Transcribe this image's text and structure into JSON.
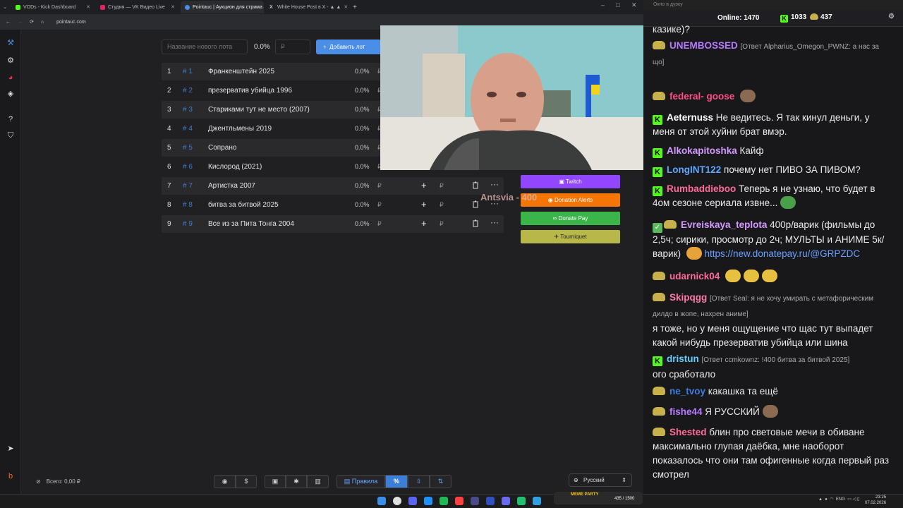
{
  "browser": {
    "tabs": [
      {
        "label": "VODs - Kick Dashboard",
        "color": "#53fc18",
        "active": false
      },
      {
        "label": "Студия — VK Видео Live",
        "color": "#e0245e",
        "active": false
      },
      {
        "label": "Pointauc | Аукцион для стрима",
        "color": "#4a8ee8",
        "active": true
      },
      {
        "label": "White House Post в X - ▲ ▲",
        "color": "#ffffff",
        "active": false
      }
    ],
    "url": "pointauc.com"
  },
  "form": {
    "lot_placeholder": "Название нового лота",
    "percent": "0.0%",
    "amount_placeholder": "₽",
    "add_label": "Добавить лот"
  },
  "lots": [
    {
      "n": "1",
      "id": "# 1",
      "name": "Франкенштейн 2025",
      "pct": "0.0%",
      "rub": "₽"
    },
    {
      "n": "2",
      "id": "# 2",
      "name": "презерватив убийца 1996",
      "pct": "0.0%",
      "rub": "₽"
    },
    {
      "n": "3",
      "id": "# 3",
      "name": "Стариками тут не место (2007)",
      "pct": "0.0%",
      "rub": "₽"
    },
    {
      "n": "4",
      "id": "# 4",
      "name": "Джентльмены 2019",
      "pct": "0.0%",
      "rub": "₽"
    },
    {
      "n": "5",
      "id": "# 5",
      "name": "Сопрано",
      "pct": "0.0%",
      "rub": "₽"
    },
    {
      "n": "6",
      "id": "# 6",
      "name": "Кислород (2021)",
      "pct": "0.0%",
      "rub": "₽"
    },
    {
      "n": "7",
      "id": "# 7",
      "name": "Артистка 2007",
      "pct": "0.0%",
      "rub": "₽"
    },
    {
      "n": "8",
      "id": "# 8",
      "name": "битва за битвой 2025",
      "pct": "0.0%",
      "rub": "₽"
    },
    {
      "n": "9",
      "id": "# 9",
      "name": "Все из за Пита Тонга 2004",
      "pct": "0.0%",
      "rub": "₽"
    }
  ],
  "donation_buttons": [
    {
      "label": "Twitch",
      "color": "#9146ff"
    },
    {
      "label": "Donation Alerts",
      "color": "#f57507"
    },
    {
      "label": "Donate Pay",
      "color": "#3bb54a"
    },
    {
      "label": "Tourniquet",
      "color": "#b8b84a"
    }
  ],
  "overlay_text": "Antsvia - 400",
  "bottom": {
    "total": "Всего: 0,00 ₽",
    "rules": "Правила",
    "percent_icon": "%",
    "language": "Русский"
  },
  "chat": {
    "window_title": "Окно в дуэку",
    "online_label": "Online:",
    "online": "1470",
    "kick_count": "1033",
    "sub_count": "437",
    "messages": [
      {
        "user": "",
        "text": "казике)?",
        "color": "#ffffff"
      },
      {
        "user": "UNEMBOSSED",
        "reply": "[Ответ Alpharius_Omegon_PWNZ: а нас за що]",
        "text": "",
        "color": "#b77bff"
      },
      {
        "user": "federal- goose",
        "text": "",
        "color": "#ff4f86"
      },
      {
        "user": "Aeternuss",
        "text": "Не ведитесь. Я так кинул деньги, у меня от этой хуйни брат вмэр.",
        "color": "#ffffff"
      },
      {
        "user": "Alkokapitoshka",
        "text": "Кайф",
        "color": "#d59aff"
      },
      {
        "user": "LongINT122",
        "text": "почему нет ПИВО ЗА ПИВОМ?",
        "color": "#5fa8ff"
      },
      {
        "user": "Rumbaddieboo",
        "text": "Теперь я не узнаю, что будет в 4ом сезоне сериала извне...",
        "color": "#ff6b9a"
      },
      {
        "user": "Evreiskaya_teplota",
        "text": "400р/варик (фильмы до 2,5ч; сирики, просмотр до 2ч; МУЛЬТЫ и АНИМЕ 5к/варик)",
        "link": "https://new.donatepay.ru/@GRPZDC",
        "color": "#d59aff"
      },
      {
        "user": "udarnick04",
        "text": "",
        "color": "#ff6b9a"
      },
      {
        "user": "Skipqgg",
        "reply": "[Ответ Seal: я не хочу умирать с метафорическим дилдо в жопе, нахрен аниме]",
        "text": "я тоже, но у меня ощущение что щас тут выпадет какой нибудь презерватив убийца или шина",
        "color": "#ff7aa8"
      },
      {
        "user": "dristun",
        "reply": "[Ответ ccmkownz: !400 битва за битвой 2025]",
        "text": "ого сработало",
        "color": "#5fd0ff"
      },
      {
        "user": "ne_tvoy",
        "text": "какашка та ещё",
        "color": "#3b7ddd"
      },
      {
        "user": "fishe44",
        "text": "Я РУССКИЙ",
        "color": "#b77bff"
      },
      {
        "user": "Shested",
        "text": "блин про световые мечи в обиване максимально глупая даёбка, мне наоборот показалось что они там офигенные когда первый раз смотрел",
        "color": "#ff6b9a"
      }
    ]
  },
  "taskbar": {
    "meme_label": "MEME PARTY",
    "meme_progress": "435 / 1500",
    "lang": "ENG",
    "time": "23:25",
    "date": "07.02.2026"
  }
}
